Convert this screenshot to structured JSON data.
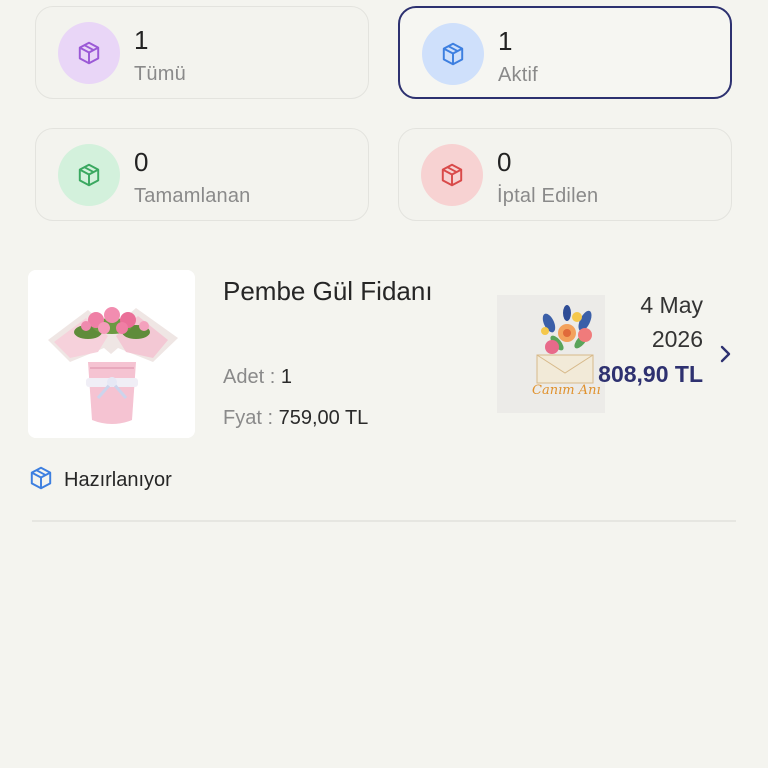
{
  "stats": [
    {
      "count": "1",
      "label": "Tümü",
      "icon": "box-icon",
      "icon_color": "#9b59d6",
      "bg": "#e9d6f7"
    },
    {
      "count": "1",
      "label": "Aktif",
      "icon": "box-icon",
      "icon_color": "#3d7fe0",
      "bg": "#cfe0fb"
    },
    {
      "count": "0",
      "label": "Tamamlanan",
      "icon": "box-icon",
      "icon_color": "#3aa860",
      "bg": "#d3f1dc"
    },
    {
      "count": "0",
      "label": "İptal Edilen",
      "icon": "box-icon",
      "icon_color": "#d94a4a",
      "bg": "#f7d2d2"
    }
  ],
  "order": {
    "product_name": "Pembe Gül Fidanı",
    "qty_label": "Adet : ",
    "qty_value": "1",
    "price_label": "Fyat : ",
    "price_value": "759,00 TL",
    "card_text": "Canım Anı",
    "date": "4 May 2026",
    "total": "808,90 TL",
    "status": "Hazırlanıyor",
    "status_icon": "box-icon",
    "chevron_icon": "chevron-right-icon"
  },
  "colors": {
    "accent": "#2e3170",
    "background": "#f4f4ef"
  }
}
